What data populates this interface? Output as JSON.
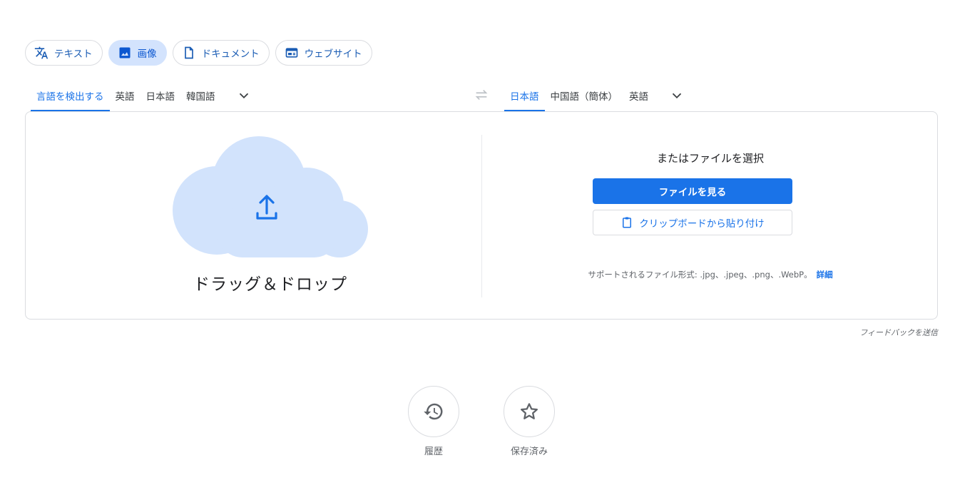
{
  "modes": [
    {
      "label": "テキスト",
      "icon": "translate-icon",
      "active": false
    },
    {
      "label": "画像",
      "icon": "image-icon",
      "active": true
    },
    {
      "label": "ドキュメント",
      "icon": "document-icon",
      "active": false
    },
    {
      "label": "ウェブサイト",
      "icon": "website-icon",
      "active": false
    }
  ],
  "source_langs": [
    "言語を検出する",
    "英語",
    "日本語",
    "韓国語"
  ],
  "source_active": 0,
  "target_langs": [
    "日本語",
    "中国語（簡体）",
    "英語"
  ],
  "target_active": 0,
  "panel": {
    "drop_text": "ドラッグ＆ドロップ",
    "or_select": "またはファイルを選択",
    "browse_button": "ファイルを見る",
    "paste_button": "クリップボードから貼り付け",
    "support_text": "サポートされるファイル形式: .jpg、.jpeg、.png、.WebP。",
    "details_link": "詳細"
  },
  "feedback": "フィードバックを送信",
  "actions": {
    "history": "履歴",
    "saved": "保存済み"
  },
  "colors": {
    "accent": "#1a73e8",
    "chip_active_bg": "#d3e3fd",
    "cloud": "#d2e3fc",
    "border": "#dadce0"
  }
}
